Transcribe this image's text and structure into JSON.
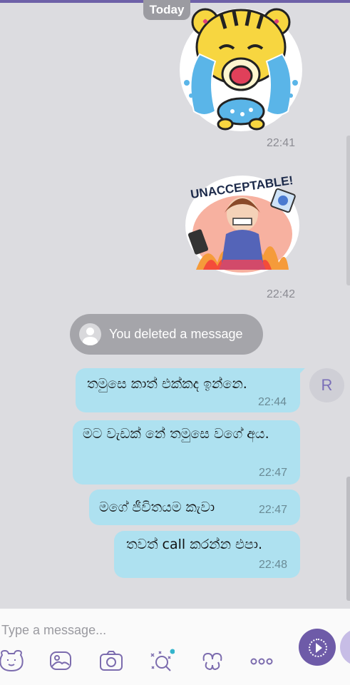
{
  "chat": {
    "date_label": "Today",
    "stickers": [
      {
        "kind": "crying-tiger-sticker",
        "time": "22:41"
      },
      {
        "kind": "unacceptable-girl-sticker",
        "caption": "UNACCEPTABLE!",
        "time": "22:42"
      }
    ],
    "deleted_notice": "You deleted a message",
    "sender_initial": "R",
    "messages": [
      {
        "text": "තමුසෙ කාත් එක්කද ඉන්නෙ.",
        "time": "22:44"
      },
      {
        "text": "මට වැඩක් නේ තමුසෙ වගේ අය.",
        "time": "22:47"
      },
      {
        "text": "මගේ ජීවිතයම කැවා",
        "time": "22:47"
      },
      {
        "text": "තවත් call කරන්න එපා.",
        "time": "22:48"
      }
    ]
  },
  "composer": {
    "placeholder": "Type a message...",
    "icons": [
      "sticker-icon",
      "gallery-icon",
      "camera-icon",
      "doodle-icon",
      "gif-icon",
      "more-icon"
    ]
  },
  "colors": {
    "accent": "#6e5ba8",
    "bubble": "#aee1f0",
    "background": "#dcdce0"
  }
}
